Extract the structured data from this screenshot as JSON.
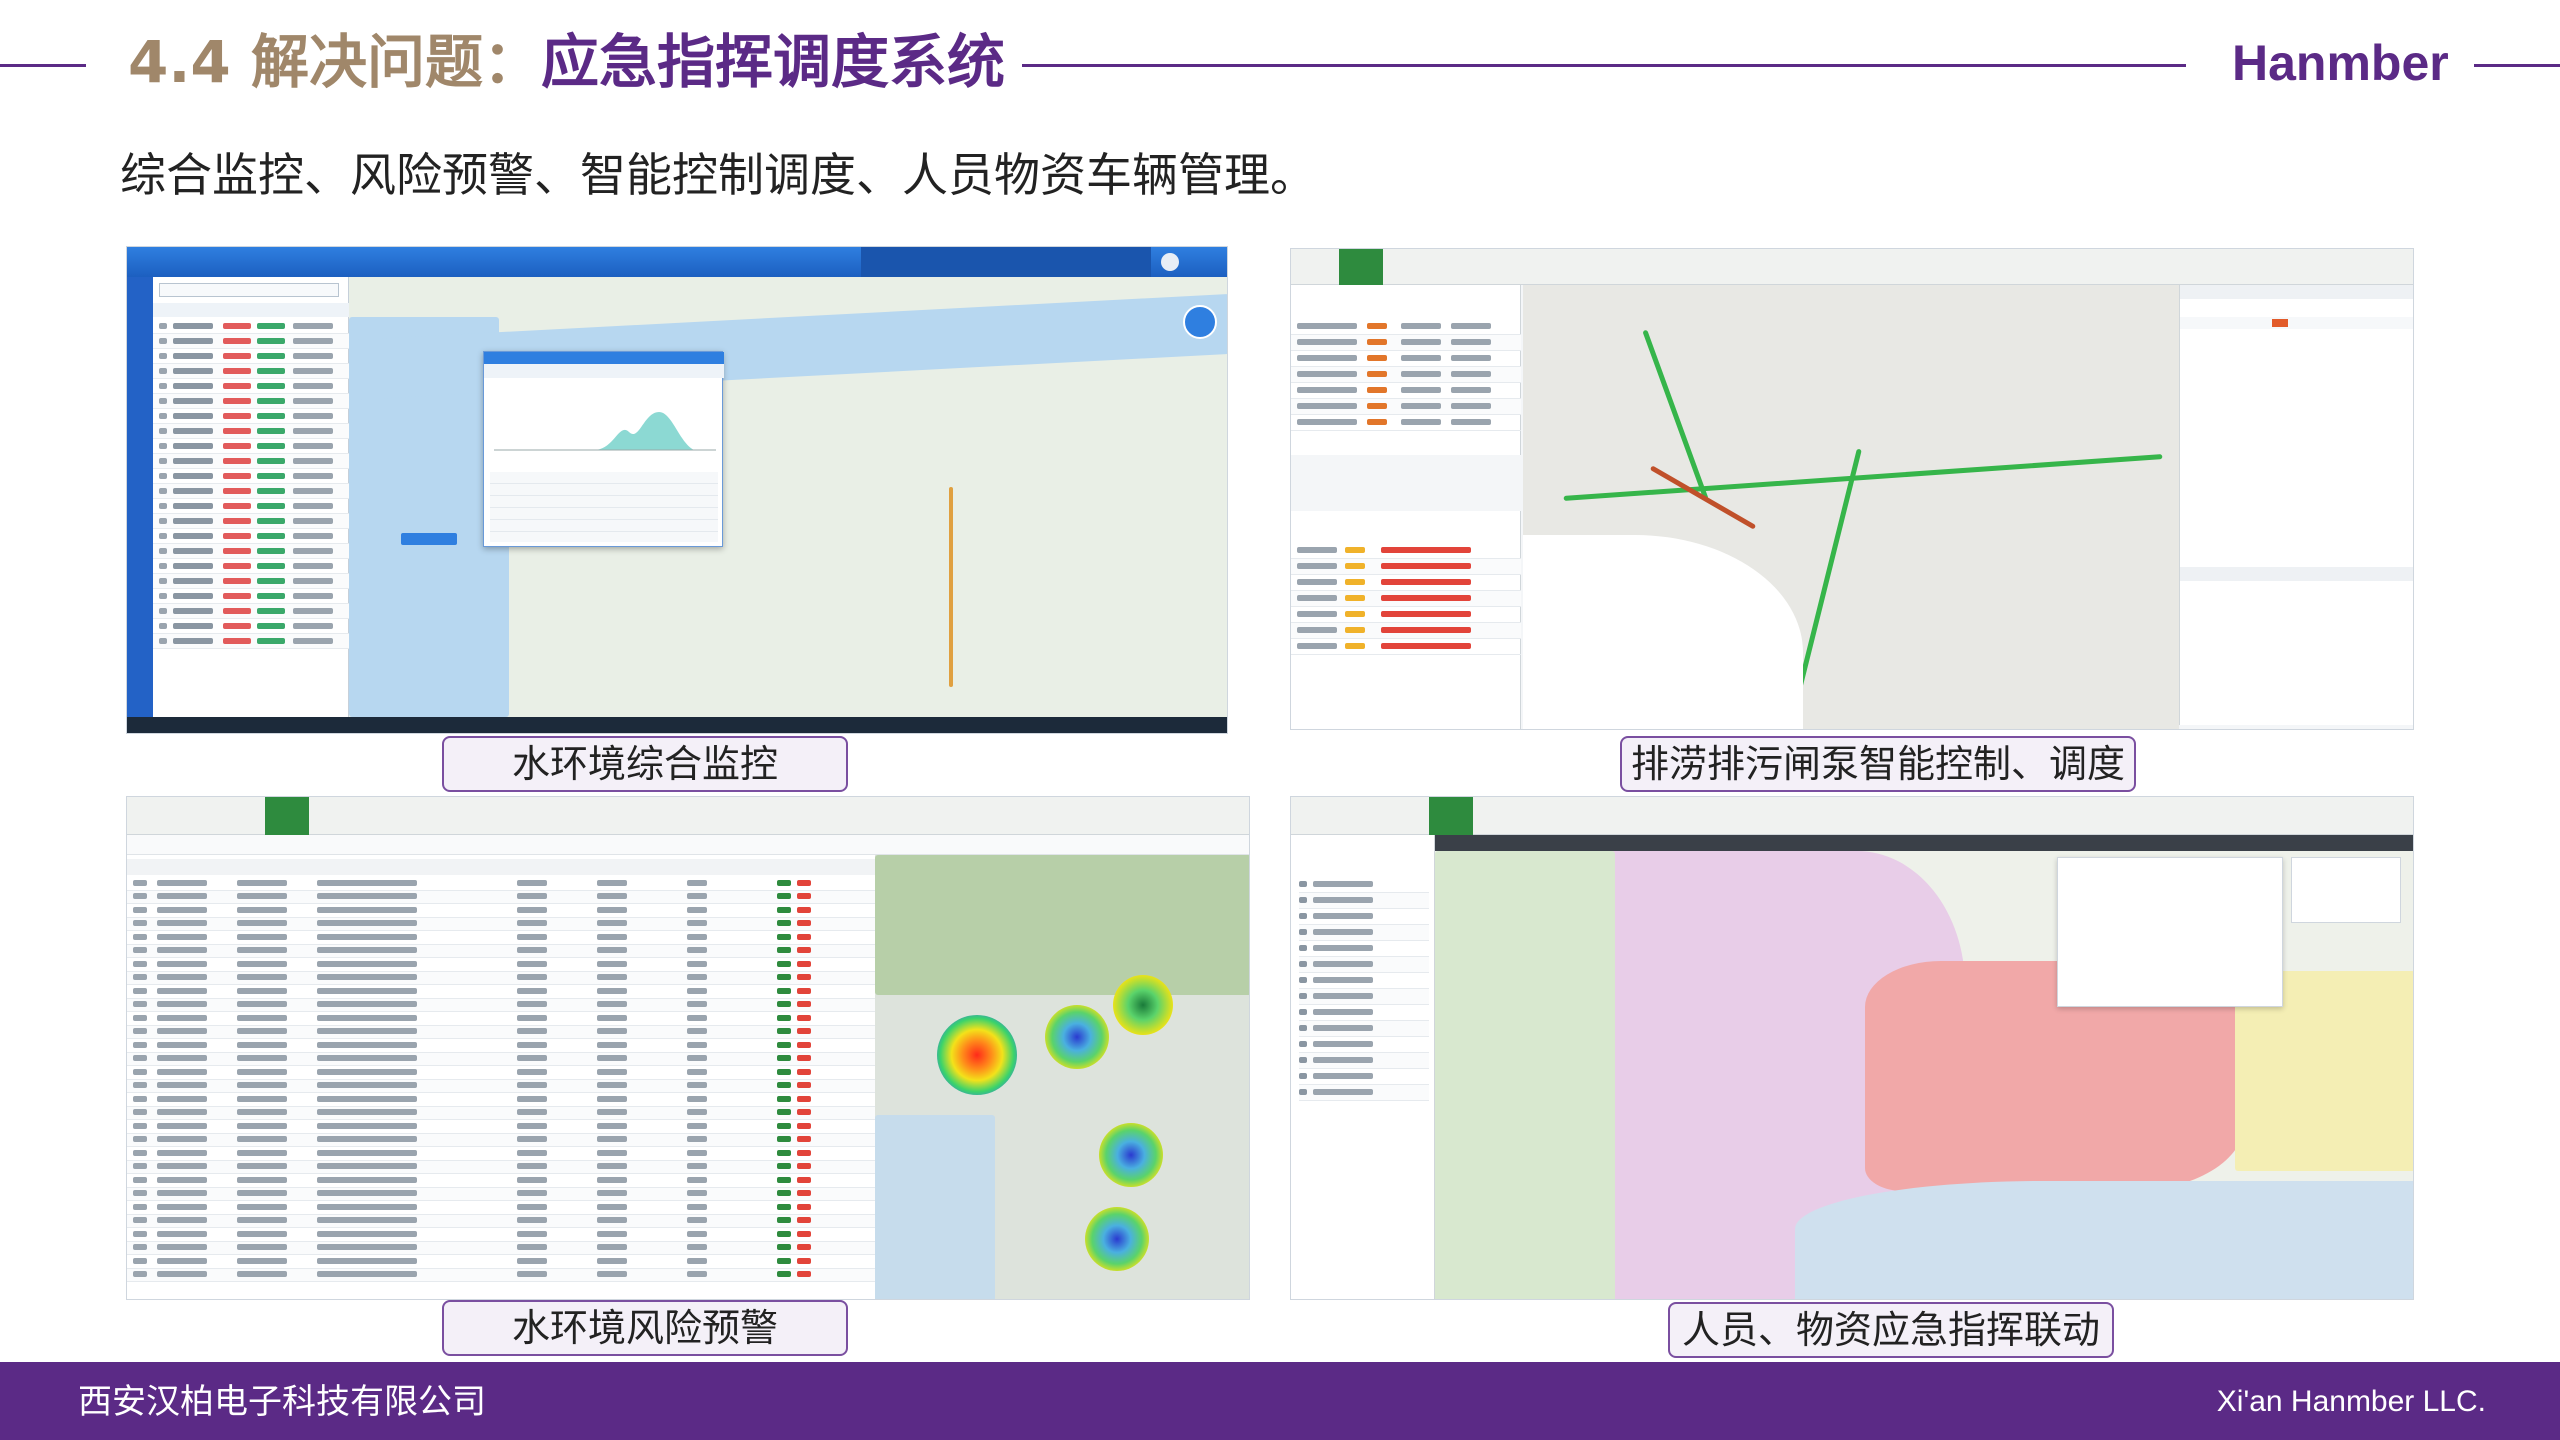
{
  "header": {
    "title_prefix": "4.4 解决问题：",
    "title_main": "应急指挥调度系统",
    "brand": "Hanmber",
    "subtitle": "综合监控、风险预警、智能控制调度、人员物资车辆管理。"
  },
  "panels": {
    "monitor": {
      "caption": "水环境综合监控"
    },
    "pump": {
      "caption": "排涝排污闸泵智能控制、调度"
    },
    "risk": {
      "caption": "水环境风险预警"
    },
    "command": {
      "caption": "人员、物资应急指挥联动"
    }
  },
  "footer": {
    "company_cn": "西安汉柏电子科技有限公司",
    "company_en": "Xi'an Hanmber LLC."
  },
  "colors": {
    "brand_purple": "#5b2a86",
    "title_tan": "#a0876a",
    "app_blue": "#2a6fd0",
    "app_green": "#2e8b3e"
  }
}
